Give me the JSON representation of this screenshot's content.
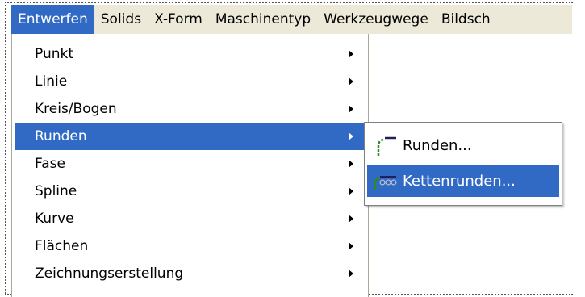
{
  "menubar": {
    "items": [
      {
        "label": "Entwerfen",
        "active": true
      },
      {
        "label": "Solids",
        "active": false
      },
      {
        "label": "X-Form",
        "active": false
      },
      {
        "label": "Maschinentyp",
        "active": false
      },
      {
        "label": "Werkzeugwege",
        "active": false
      },
      {
        "label": "Bildsch",
        "active": false
      }
    ]
  },
  "dropdown": {
    "items": [
      {
        "label": "Punkt"
      },
      {
        "label": "Linie"
      },
      {
        "label": "Kreis/Bogen"
      },
      {
        "label": "Runden"
      },
      {
        "label": "Fase"
      },
      {
        "label": "Spline"
      },
      {
        "label": "Kurve"
      },
      {
        "label": "Flächen"
      },
      {
        "label": "Zeichnungserstellung"
      }
    ],
    "selected_index": 3
  },
  "submenu": {
    "items": [
      {
        "label": "Runden...",
        "icon": "fillet-icon"
      },
      {
        "label": "Kettenrunden...",
        "icon": "chain-fillet-icon"
      }
    ],
    "selected_index": 1
  },
  "colors": {
    "highlight": "#316ac5",
    "menubar_bg": "#ece9d8"
  }
}
